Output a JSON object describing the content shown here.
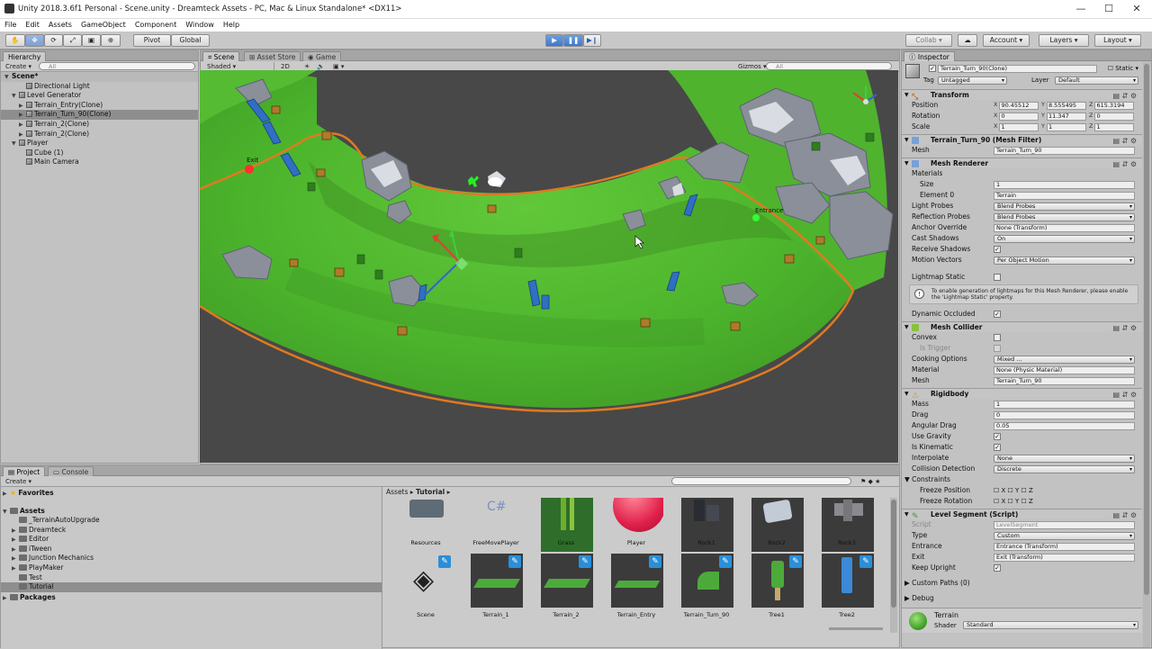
{
  "window": {
    "title": "Unity 2018.3.6f1 Personal - Scene.unity - Dreamteck Assets - PC, Mac & Linux Standalone* <DX11>"
  },
  "menu": [
    "File",
    "Edit",
    "Assets",
    "GameObject",
    "Component",
    "Window",
    "Help"
  ],
  "toolbar": {
    "pivot": "Pivot",
    "global": "Global",
    "collab": "Collab ▾",
    "account": "Account",
    "layers": "Layers",
    "layout": "Layout"
  },
  "hierarchy": {
    "tab": "Hierarchy",
    "create": "Create",
    "search_placeholder": "All",
    "scene": "Scene*",
    "items": [
      {
        "label": "Directional Light",
        "indent": 2,
        "arrow": ""
      },
      {
        "label": "Level Generator",
        "indent": 1,
        "arrow": "▼"
      },
      {
        "label": "Terrain_Entry(Clone)",
        "indent": 2,
        "arrow": "▶"
      },
      {
        "label": "Terrain_Turn_90(Clone)",
        "indent": 2,
        "arrow": "▶",
        "selected": true
      },
      {
        "label": "Terrain_2(Clone)",
        "indent": 2,
        "arrow": "▶"
      },
      {
        "label": "Terrain_2(Clone)",
        "indent": 2,
        "arrow": "▶"
      },
      {
        "label": "Player",
        "indent": 1,
        "arrow": "▼"
      },
      {
        "label": "Cube (1)",
        "indent": 2,
        "arrow": ""
      },
      {
        "label": "Main Camera",
        "indent": 2,
        "arrow": ""
      }
    ]
  },
  "scene_view": {
    "tabs": [
      "Scene",
      "Asset Store",
      "Game"
    ],
    "shading": "Shaded",
    "mode_2d": "2D",
    "gizmos": "Gizmos",
    "search_placeholder": "All",
    "labels": {
      "exit": "Exit",
      "entrance": "Entrance"
    }
  },
  "project": {
    "tabs": [
      "Project",
      "Console"
    ],
    "create": "Create",
    "favorites": "Favorites",
    "assets_root": "Assets",
    "packages": "Packages",
    "folders": [
      "_TerrainAutoUpgrade",
      "Dreamteck",
      "Editor",
      "iTween",
      "Junction Mechanics",
      "PlayMaker",
      "Test",
      "Tutorial"
    ],
    "selected_folder": "Tutorial",
    "breadcrumb": [
      "Assets",
      "Tutorial"
    ],
    "assets_row1": [
      "Resources",
      "FreeMovePlayer",
      "Grass",
      "Player",
      "Rock1",
      "Rock2",
      "Rock3"
    ],
    "assets_row2": [
      "Scene",
      "Terrain_1",
      "Terrain_2",
      "Terrain_Entry",
      "Terrain_Turn_90",
      "Tree1",
      "Tree2"
    ]
  },
  "inspector": {
    "tab": "Inspector",
    "object_name": "Terrain_Turn_90(Clone)",
    "static": "Static",
    "tag_label": "Tag",
    "tag": "Untagged",
    "layer_label": "Layer",
    "layer": "Default",
    "transform": {
      "title": "Transform",
      "position": {
        "label": "Position",
        "x": "90.45512",
        "y": "8.555495",
        "z": "615.3194"
      },
      "rotation": {
        "label": "Rotation",
        "x": "0",
        "y": "11.347",
        "z": "0"
      },
      "scale": {
        "label": "Scale",
        "x": "1",
        "y": "1",
        "z": "1"
      }
    },
    "mesh_filter": {
      "title": "Terrain_Turn_90 (Mesh Filter)",
      "mesh_label": "Mesh",
      "mesh": "Terrain_Turn_90"
    },
    "mesh_renderer": {
      "title": "Mesh Renderer",
      "materials": "Materials",
      "size_label": "Size",
      "size": "1",
      "element0_label": "Element 0",
      "element0": "Terrain",
      "light_probes_label": "Light Probes",
      "light_probes": "Blend Probes",
      "reflection_probes_label": "Reflection Probes",
      "reflection_probes": "Blend Probes",
      "anchor_override_label": "Anchor Override",
      "anchor_override": "None (Transform)",
      "cast_shadows_label": "Cast Shadows",
      "cast_shadows": "On",
      "receive_shadows_label": "Receive Shadows",
      "motion_vectors_label": "Motion Vectors",
      "motion_vectors": "Per Object Motion",
      "lightmap_static_label": "Lightmap Static",
      "info": "To enable generation of lightmaps for this Mesh Renderer, please enable the 'Lightmap Static' property.",
      "dynamic_occluded_label": "Dynamic Occluded"
    },
    "mesh_collider": {
      "title": "Mesh Collider",
      "convex_label": "Convex",
      "is_trigger_label": "Is Trigger",
      "cooking_label": "Cooking Options",
      "cooking": "Mixed ...",
      "material_label": "Material",
      "material": "None (Physic Material)",
      "mesh_label": "Mesh",
      "mesh": "Terrain_Turn_90"
    },
    "rigidbody": {
      "title": "Rigidbody",
      "mass_label": "Mass",
      "mass": "1",
      "drag_label": "Drag",
      "drag": "0",
      "angular_drag_label": "Angular Drag",
      "angular_drag": "0.05",
      "use_gravity_label": "Use Gravity",
      "is_kinematic_label": "Is Kinematic",
      "interpolate_label": "Interpolate",
      "interpolate": "None",
      "collision_label": "Collision Detection",
      "collision": "Discrete",
      "constraints_label": "Constraints",
      "freeze_pos_label": "Freeze Position",
      "freeze_rot_label": "Freeze Rotation"
    },
    "level_segment": {
      "title": "Level Segment (Script)",
      "script_label": "Script",
      "script": "LevelSegment",
      "type_label": "Type",
      "type": "Custom",
      "entrance_label": "Entrance",
      "entrance": "Entrance (Transform)",
      "exit_label": "Exit",
      "exit": "Exit (Transform)",
      "keep_upright_label": "Keep Upright",
      "custom_paths": "Custom Paths (0)",
      "debug": "Debug"
    },
    "material": {
      "name": "Terrain",
      "shader_label": "Shader",
      "shader": "Standard"
    }
  }
}
